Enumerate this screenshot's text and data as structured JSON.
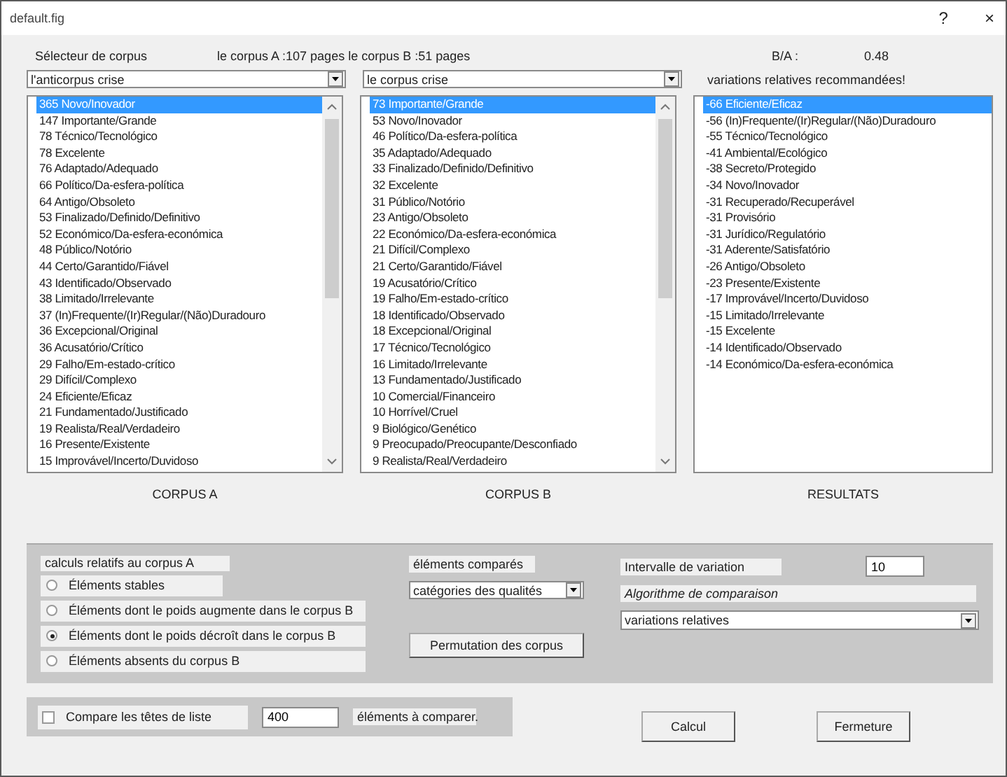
{
  "window": {
    "title": "default.fig",
    "help": "?",
    "close": "×"
  },
  "header": {
    "selector_label": "Sélecteur de corpus",
    "pages_info": "le corpus A :107 pages le corpus B :51 pages",
    "ratio_label": "B/A :",
    "ratio_value": "0.48"
  },
  "combos": [
    {
      "value": "l'anticorpus crise"
    },
    {
      "value": "le corpus crise"
    }
  ],
  "recommendation": "variations relatives recommandées!",
  "lists": [
    {
      "caption": "CORPUS A",
      "scrollbar": true,
      "items": [
        {
          "text": "365 Novo/Inovador",
          "selected": true
        },
        {
          "text": "147 Importante/Grande",
          "selected": false
        },
        {
          "text": "78 Técnico/Tecnológico",
          "selected": false
        },
        {
          "text": "78 Excelente",
          "selected": false
        },
        {
          "text": "76 Adaptado/Adequado",
          "selected": false
        },
        {
          "text": "66 Político/Da-esfera-política",
          "selected": false
        },
        {
          "text": "64 Antigo/Obsoleto",
          "selected": false
        },
        {
          "text": "53 Finalizado/Definido/Definitivo",
          "selected": false
        },
        {
          "text": "52 Económico/Da-esfera-económica",
          "selected": false
        },
        {
          "text": "48 Público/Notório",
          "selected": false
        },
        {
          "text": "44 Certo/Garantido/Fiável",
          "selected": false
        },
        {
          "text": "43 Identificado/Observado",
          "selected": false
        },
        {
          "text": "38 Limitado/Irrelevante",
          "selected": false
        },
        {
          "text": "37 (In)Frequente/(Ir)Regular/(Não)Duradouro",
          "selected": false
        },
        {
          "text": "36 Excepcional/Original",
          "selected": false
        },
        {
          "text": "36 Acusatório/Crítico",
          "selected": false
        },
        {
          "text": "29 Falho/Em-estado-crítico",
          "selected": false
        },
        {
          "text": "29 Difícil/Complexo",
          "selected": false
        },
        {
          "text": "24 Eficiente/Eficaz",
          "selected": false
        },
        {
          "text": "21 Fundamentado/Justificado",
          "selected": false
        },
        {
          "text": "19 Realista/Real/Verdadeiro",
          "selected": false
        },
        {
          "text": "16 Presente/Existente",
          "selected": false
        },
        {
          "text": "15 Improvável/Incerto/Duvidoso",
          "selected": false
        }
      ]
    },
    {
      "caption": "CORPUS B",
      "scrollbar": true,
      "items": [
        {
          "text": "73 Importante/Grande",
          "selected": true
        },
        {
          "text": "53 Novo/Inovador",
          "selected": false
        },
        {
          "text": "46 Político/Da-esfera-política",
          "selected": false
        },
        {
          "text": "35 Adaptado/Adequado",
          "selected": false
        },
        {
          "text": "33 Finalizado/Definido/Definitivo",
          "selected": false
        },
        {
          "text": "32 Excelente",
          "selected": false
        },
        {
          "text": "31 Público/Notório",
          "selected": false
        },
        {
          "text": "23 Antigo/Obsoleto",
          "selected": false
        },
        {
          "text": "22 Económico/Da-esfera-económica",
          "selected": false
        },
        {
          "text": "21 Difícil/Complexo",
          "selected": false
        },
        {
          "text": "21 Certo/Garantido/Fiável",
          "selected": false
        },
        {
          "text": "19 Acusatório/Crítico",
          "selected": false
        },
        {
          "text": "19 Falho/Em-estado-crítico",
          "selected": false
        },
        {
          "text": "18 Identificado/Observado",
          "selected": false
        },
        {
          "text": "18 Excepcional/Original",
          "selected": false
        },
        {
          "text": "17 Técnico/Tecnológico",
          "selected": false
        },
        {
          "text": "16 Limitado/Irrelevante",
          "selected": false
        },
        {
          "text": "13 Fundamentado/Justificado",
          "selected": false
        },
        {
          "text": "10 Comercial/Financeiro",
          "selected": false
        },
        {
          "text": "10 Horrível/Cruel",
          "selected": false
        },
        {
          "text": "9 Biológico/Genético",
          "selected": false
        },
        {
          "text": "9 Preocupado/Preocupante/Desconfiado",
          "selected": false
        },
        {
          "text": "9 Realista/Real/Verdadeiro",
          "selected": false
        }
      ]
    },
    {
      "caption": "RESULTATS",
      "scrollbar": false,
      "items": [
        {
          "text": "-66 Eficiente/Eficaz",
          "selected": true
        },
        {
          "text": "-56 (In)Frequente/(Ir)Regular/(Não)Duradouro",
          "selected": false
        },
        {
          "text": "-55 Técnico/Tecnológico",
          "selected": false
        },
        {
          "text": "-41 Ambiental/Ecológico",
          "selected": false
        },
        {
          "text": "-38 Secreto/Protegido",
          "selected": false
        },
        {
          "text": "-34 Novo/Inovador",
          "selected": false
        },
        {
          "text": "-31 Recuperado/Recuperável",
          "selected": false
        },
        {
          "text": "-31 Provisório",
          "selected": false
        },
        {
          "text": "-31 Jurídico/Regulatório",
          "selected": false
        },
        {
          "text": "-31 Aderente/Satisfatório",
          "selected": false
        },
        {
          "text": "-26 Antigo/Obsoleto",
          "selected": false
        },
        {
          "text": "-23 Presente/Existente",
          "selected": false
        },
        {
          "text": "-17 Improvável/Incerto/Duvidoso",
          "selected": false
        },
        {
          "text": "-15 Limitado/Irrelevante",
          "selected": false
        },
        {
          "text": "-15 Excelente",
          "selected": false
        },
        {
          "text": "-14 Identificado/Observado",
          "selected": false
        },
        {
          "text": "-14 Económico/Da-esfera-económica",
          "selected": false
        }
      ]
    }
  ],
  "options": {
    "group_label": "calculs relatifs au corpus A",
    "radios": [
      {
        "label": "Éléments stables",
        "selected": false
      },
      {
        "label": "Éléments dont le poids augmente dans le corpus B",
        "selected": false
      },
      {
        "label": "Éléments dont le poids décroît dans le corpus B",
        "selected": true
      },
      {
        "label": "Éléments absents du corpus B",
        "selected": false
      }
    ],
    "compared_label": "éléments comparés",
    "compared_value": "catégories des qualités",
    "swap_button": "Permutation des corpus",
    "interval_label": "Intervalle de variation",
    "interval_value": "10",
    "algorithm_label": "Algorithme de comparaison",
    "algorithm_value": "variations relatives"
  },
  "footer": {
    "compare_heads": {
      "label": "Compare les têtes de liste",
      "checked": false
    },
    "count_value": "400",
    "count_label": "éléments à comparer.",
    "buttons": [
      "Calcul",
      "Fermeture"
    ]
  }
}
